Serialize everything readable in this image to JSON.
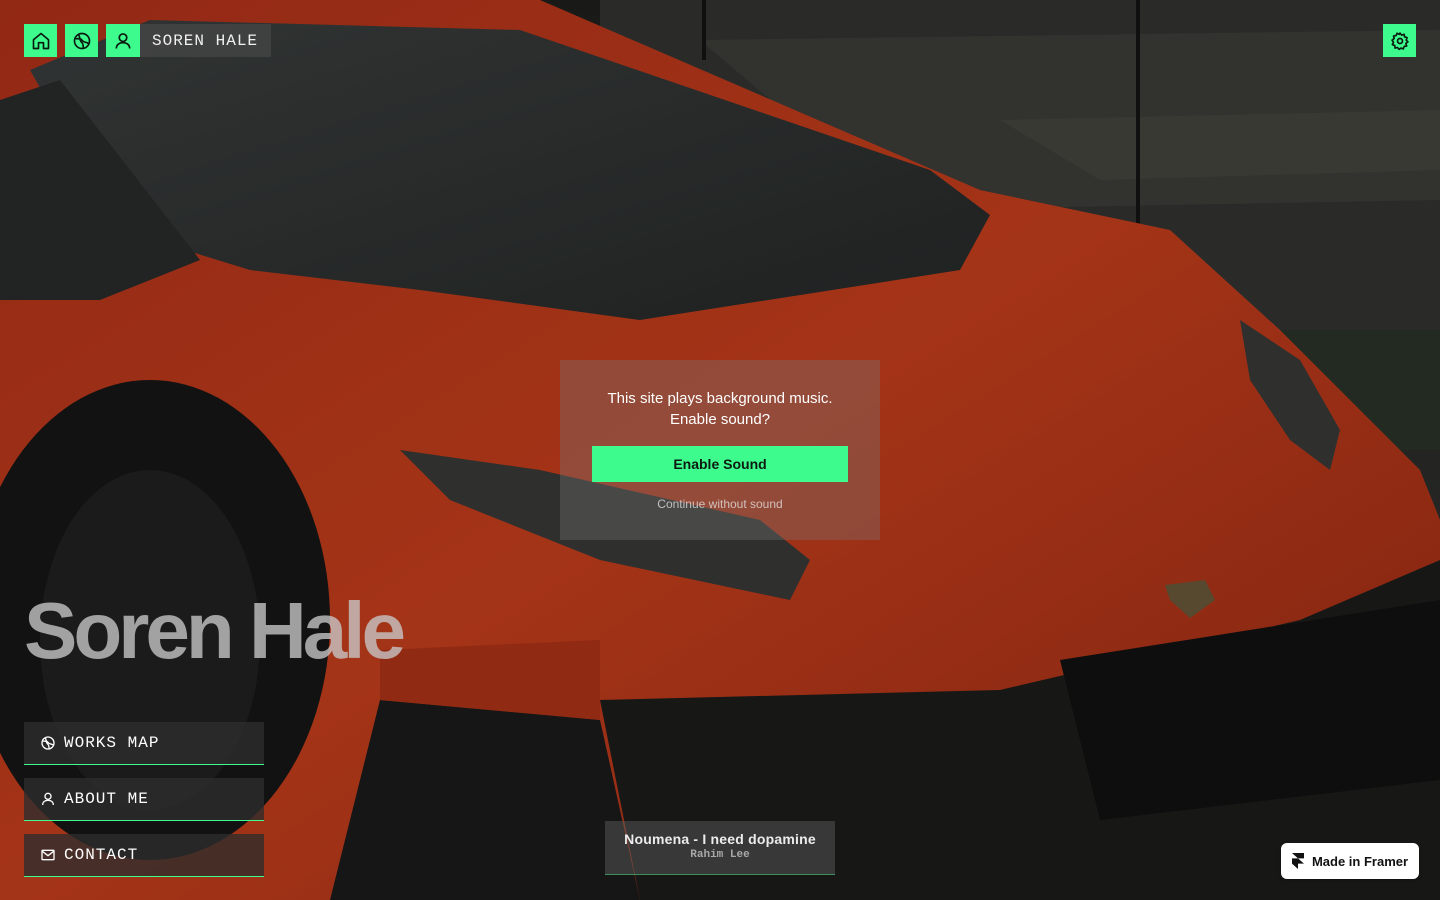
{
  "topbar": {
    "name_label": "SOREN HALE"
  },
  "modal": {
    "message": "This site plays background music.\nEnable sound?",
    "enable_label": "Enable Sound",
    "skip_label": "Continue without sound"
  },
  "hero": {
    "title": "Soren Hale"
  },
  "nav": {
    "items": [
      {
        "label": "WORKS MAP",
        "icon": "globe-icon"
      },
      {
        "label": "ABOUT ME",
        "icon": "user-icon"
      },
      {
        "label": "CONTACT",
        "icon": "mail-icon"
      }
    ]
  },
  "player": {
    "track": "Noumena - I need dopamine",
    "artist": "Rahim Lee"
  },
  "badge": {
    "label": "Made in Framer"
  },
  "colors": {
    "accent": "#3dfb8c",
    "car": "#c6391b"
  }
}
